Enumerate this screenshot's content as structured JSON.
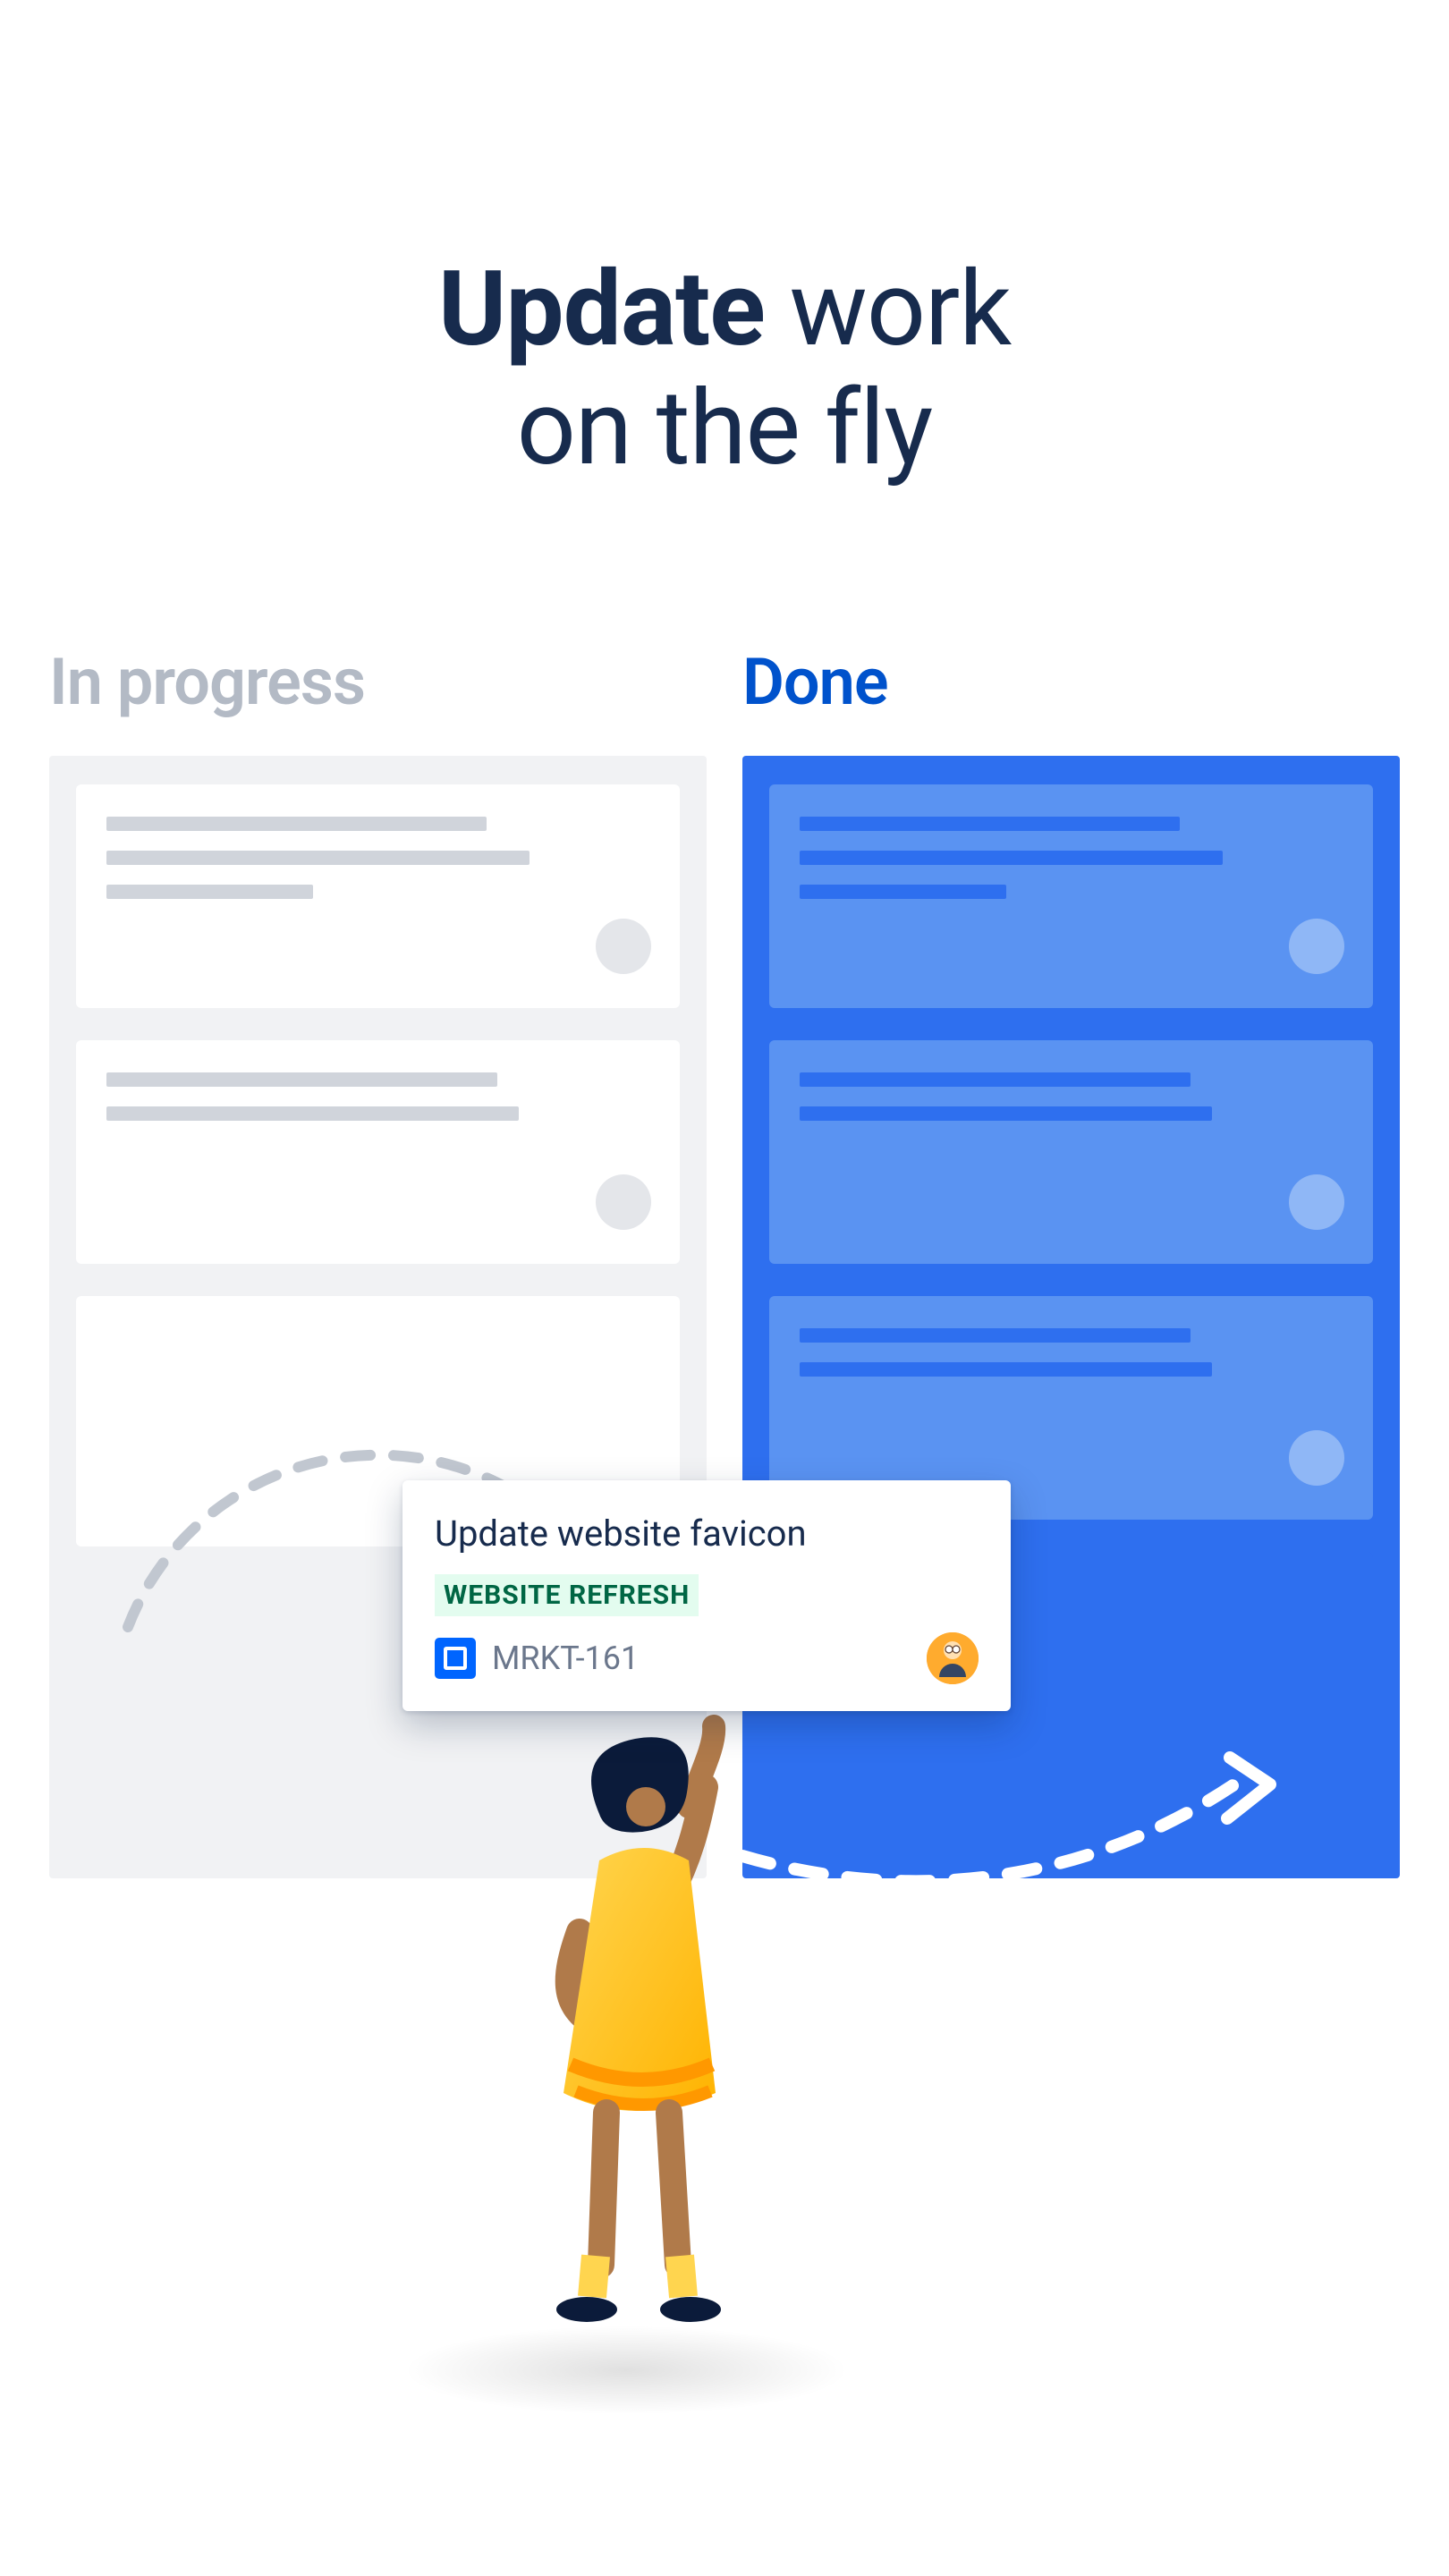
{
  "headline": {
    "strong": "Update",
    "rest1": " work",
    "line2": "on the fly"
  },
  "columns": {
    "in_progress": {
      "label": "In progress"
    },
    "done": {
      "label": "Done"
    }
  },
  "drag_card": {
    "title": "Update website favicon",
    "tag": "WEBSITE REFRESH",
    "key": "MRKT-161"
  },
  "colors": {
    "heading": "#172b4d",
    "progress_label": "#b3bac5",
    "done_label": "#0052cc",
    "done_bg": "#2e6fef",
    "tag_bg": "#e3fcef",
    "tag_text": "#006644"
  }
}
